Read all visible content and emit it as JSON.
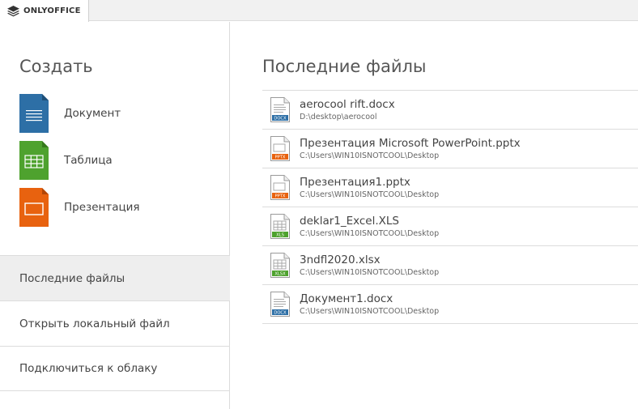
{
  "app": {
    "brand": "ONLYOFFICE"
  },
  "create": {
    "title": "Создать",
    "items": [
      {
        "label": "Документ",
        "icon": "document-icon",
        "color": "#2d6fa6"
      },
      {
        "label": "Таблица",
        "icon": "spreadsheet-icon",
        "color": "#4ea22e"
      },
      {
        "label": "Презентация",
        "icon": "presentation-icon",
        "color": "#e8620f"
      }
    ]
  },
  "menu": {
    "items": [
      {
        "label": "Последние файлы",
        "active": true
      },
      {
        "label": "Открыть локальный файл",
        "active": false
      },
      {
        "label": "Подключиться к облаку",
        "active": false
      }
    ]
  },
  "recent": {
    "title": "Последние файлы",
    "files": [
      {
        "name": "aerocool rift.docx",
        "path": "D:\\desktop\\aerocool",
        "type": "DOCX",
        "type_color": "#2d6fa6"
      },
      {
        "name": "Презентация Microsoft PowerPoint.pptx",
        "path": "C:\\Users\\WIN10ISNOTCOOL\\Desktop",
        "type": "PPTX",
        "type_color": "#e8620f"
      },
      {
        "name": "Презентация1.pptx",
        "path": "C:\\Users\\WIN10ISNOTCOOL\\Desktop",
        "type": "PPTX",
        "type_color": "#e8620f"
      },
      {
        "name": "deklar1_Excel.XLS",
        "path": "C:\\Users\\WIN10ISNOTCOOL\\Desktop",
        "type": "XLS",
        "type_color": "#4ea22e"
      },
      {
        "name": "3ndfl2020.xlsx",
        "path": "C:\\Users\\WIN10ISNOTCOOL\\Desktop",
        "type": "XLSX",
        "type_color": "#4ea22e"
      },
      {
        "name": "Документ1.docx",
        "path": "C:\\Users\\WIN10ISNOTCOOL\\Desktop",
        "type": "DOCX",
        "type_color": "#2d6fa6"
      }
    ]
  }
}
